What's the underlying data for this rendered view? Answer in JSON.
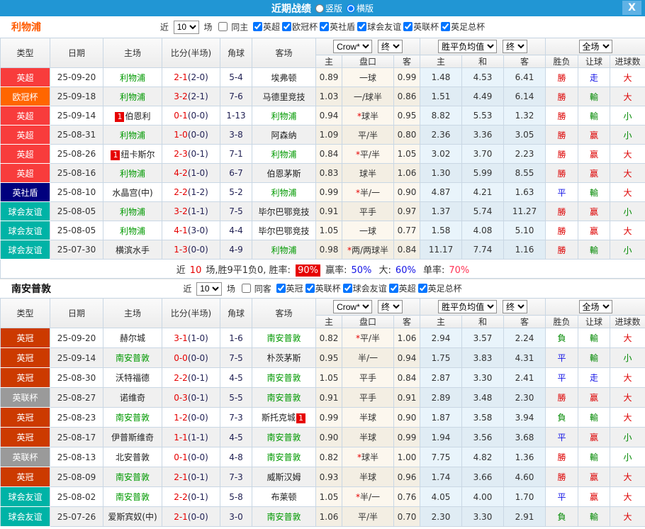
{
  "titlebar": {
    "title": "近期战绩",
    "radio_vertical": "竖版",
    "radio_horizontal": "横版",
    "close_glyph": "X"
  },
  "table_header": {
    "type": "类型",
    "date": "日期",
    "home": "主场",
    "score": "比分(半场)",
    "corner": "角球",
    "away": "客场",
    "odds_home": "主",
    "handicap": "盘口",
    "odds_away": "客",
    "avg_home": "主",
    "avg_draw": "和",
    "avg_away": "客",
    "result": "胜负",
    "handicap_result": "让球",
    "goals": "进球数",
    "dd_crow": "Crow*",
    "dd_final": "终",
    "dd_wdl_avg": "胜平负均值",
    "dd_full": "全场"
  },
  "league_colors": {
    "英超": "#f83c3c",
    "欧冠杯": "#ff6600",
    "英社盾": "#00007e",
    "球会友谊": "#00b3a6",
    "英冠": "#cc3a00",
    "英联杯": "#9a9a9a"
  },
  "result_colors": {
    "r": "#dd0000",
    "b": "#1414e6",
    "g": "#008800"
  },
  "sections": [
    {
      "team": "利物浦",
      "near_label": "近",
      "games_value": "10",
      "games_label": "场",
      "same_label": "同主",
      "same_checked": false,
      "leagues": [
        "英超",
        "欧冠杯",
        "英社盾",
        "球会友谊",
        "英联杯",
        "英足总杯"
      ],
      "rows": [
        {
          "lg": "英超",
          "dt": "25-09-20",
          "hm": "利物浦",
          "hg": true,
          "hb": false,
          "sc": "2-1",
          "hf": "(2-0)",
          "cn": "5-4",
          "aw": "埃弗顿",
          "ag": false,
          "ab": false,
          "o1": "0.89",
          "st": false,
          "hd": "一球",
          "o2": "0.99",
          "m1": "1.48",
          "mx": "4.53",
          "m2": "6.41",
          "rs": "勝",
          "rc": "r",
          "lt": "走",
          "lc": "b",
          "gl": "大",
          "gc": "r"
        },
        {
          "lg": "欧冠杯",
          "dt": "25-09-18",
          "hm": "利物浦",
          "hg": true,
          "hb": false,
          "sc": "3-2",
          "hf": "(2-1)",
          "cn": "7-6",
          "aw": "马德里竞技",
          "ag": false,
          "ab": false,
          "o1": "1.03",
          "st": false,
          "hd": "一/球半",
          "o2": "0.86",
          "m1": "1.51",
          "mx": "4.49",
          "m2": "6.14",
          "rs": "勝",
          "rc": "r",
          "lt": "輸",
          "lc": "g",
          "gl": "大",
          "gc": "r"
        },
        {
          "lg": "英超",
          "dt": "25-09-14",
          "hm": "伯恩利",
          "hg": false,
          "hb": true,
          "sc": "0-1",
          "hf": "(0-0)",
          "cn": "1-13",
          "aw": "利物浦",
          "ag": true,
          "ab": false,
          "o1": "0.94",
          "st": true,
          "hd": "球半",
          "o2": "0.95",
          "m1": "8.82",
          "mx": "5.53",
          "m2": "1.32",
          "rs": "勝",
          "rc": "r",
          "lt": "輸",
          "lc": "g",
          "gl": "小",
          "gc": "g"
        },
        {
          "lg": "英超",
          "dt": "25-08-31",
          "hm": "利物浦",
          "hg": true,
          "hb": false,
          "sc": "1-0",
          "hf": "(0-0)",
          "cn": "3-8",
          "aw": "阿森纳",
          "ag": false,
          "ab": false,
          "o1": "1.09",
          "st": false,
          "hd": "平/半",
          "o2": "0.80",
          "m1": "2.36",
          "mx": "3.36",
          "m2": "3.05",
          "rs": "勝",
          "rc": "r",
          "lt": "赢",
          "lc": "r",
          "gl": "小",
          "gc": "g"
        },
        {
          "lg": "英超",
          "dt": "25-08-26",
          "hm": "纽卡斯尔",
          "hg": false,
          "hb": true,
          "sc": "2-3",
          "hf": "(0-1)",
          "cn": "7-1",
          "aw": "利物浦",
          "ag": true,
          "ab": false,
          "o1": "0.84",
          "st": true,
          "hd": "平/半",
          "o2": "1.05",
          "m1": "3.02",
          "mx": "3.70",
          "m2": "2.23",
          "rs": "勝",
          "rc": "r",
          "lt": "赢",
          "lc": "r",
          "gl": "大",
          "gc": "r"
        },
        {
          "lg": "英超",
          "dt": "25-08-16",
          "hm": "利物浦",
          "hg": true,
          "hb": false,
          "sc": "4-2",
          "hf": "(1-0)",
          "cn": "6-7",
          "aw": "伯恩茅斯",
          "ag": false,
          "ab": false,
          "o1": "0.83",
          "st": false,
          "hd": "球半",
          "o2": "1.06",
          "m1": "1.30",
          "mx": "5.99",
          "m2": "8.55",
          "rs": "勝",
          "rc": "r",
          "lt": "赢",
          "lc": "r",
          "gl": "大",
          "gc": "r"
        },
        {
          "lg": "英社盾",
          "dt": "25-08-10",
          "hm": "水晶宫(中)",
          "hg": false,
          "hb": false,
          "sc": "2-2",
          "hf": "(1-2)",
          "cn": "5-2",
          "aw": "利物浦",
          "ag": true,
          "ab": false,
          "o1": "0.99",
          "st": true,
          "hd": "半/一",
          "o2": "0.90",
          "m1": "4.87",
          "mx": "4.21",
          "m2": "1.63",
          "rs": "平",
          "rc": "b",
          "lt": "輸",
          "lc": "g",
          "gl": "大",
          "gc": "r"
        },
        {
          "lg": "球会友谊",
          "dt": "25-08-05",
          "hm": "利物浦",
          "hg": true,
          "hb": false,
          "sc": "3-2",
          "hf": "(1-1)",
          "cn": "7-5",
          "aw": "毕尔巴鄂竞技",
          "ag": false,
          "ab": false,
          "o1": "0.91",
          "st": false,
          "hd": "平手",
          "o2": "0.97",
          "m1": "1.37",
          "mx": "5.74",
          "m2": "11.27",
          "rs": "勝",
          "rc": "r",
          "lt": "赢",
          "lc": "r",
          "gl": "小",
          "gc": "g"
        },
        {
          "lg": "球会友谊",
          "dt": "25-08-05",
          "hm": "利物浦",
          "hg": true,
          "hb": false,
          "sc": "4-1",
          "hf": "(3-0)",
          "cn": "4-4",
          "aw": "毕尔巴鄂竞技",
          "ag": false,
          "ab": false,
          "o1": "1.05",
          "st": false,
          "hd": "一球",
          "o2": "0.77",
          "m1": "1.58",
          "mx": "4.08",
          "m2": "5.10",
          "rs": "勝",
          "rc": "r",
          "lt": "赢",
          "lc": "r",
          "gl": "大",
          "gc": "r"
        },
        {
          "lg": "球会友谊",
          "dt": "25-07-30",
          "hm": "横滨水手",
          "hg": false,
          "hb": false,
          "sc": "1-3",
          "hf": "(0-0)",
          "cn": "4-9",
          "aw": "利物浦",
          "ag": true,
          "ab": false,
          "o1": "0.98",
          "st": true,
          "hd": "两/两球半",
          "o2": "0.84",
          "m1": "11.17",
          "mx": "7.74",
          "m2": "1.16",
          "rs": "勝",
          "rc": "r",
          "lt": "輸",
          "lc": "g",
          "gl": "小",
          "gc": "g"
        }
      ],
      "summary": [
        {
          "text": "近",
          "color": "#333333"
        },
        {
          "text": "10",
          "color": "#e60000"
        },
        {
          "text": "场,胜9平1负0, 胜率: ",
          "color": "#333333"
        },
        {
          "text": "90%",
          "color": "#ffffff",
          "bg": "#e60000"
        },
        {
          "text": " 赢率:",
          "color": "#333333"
        },
        {
          "text": "50%",
          "color": "#1414e6"
        },
        {
          "text": " 大:",
          "color": "#333333"
        },
        {
          "text": "60%",
          "color": "#1414e6"
        },
        {
          "text": " 单率:",
          "color": "#333333"
        },
        {
          "text": "70%",
          "color": "#ff3355"
        }
      ]
    },
    {
      "team": "南安普敦",
      "near_label": "近",
      "games_value": "10",
      "games_label": "场",
      "same_label": "同客",
      "same_checked": false,
      "leagues": [
        "英冠",
        "英联杯",
        "球会友谊",
        "英超",
        "英足总杯"
      ],
      "rows": [
        {
          "lg": "英冠",
          "dt": "25-09-20",
          "hm": "赫尔城",
          "hg": false,
          "hb": false,
          "sc": "3-1",
          "hf": "(1-0)",
          "cn": "1-6",
          "aw": "南安普敦",
          "ag": true,
          "ab": false,
          "o1": "0.82",
          "st": true,
          "hd": "平/半",
          "o2": "1.06",
          "m1": "2.94",
          "mx": "3.57",
          "m2": "2.24",
          "rs": "負",
          "rc": "g",
          "lt": "輸",
          "lc": "g",
          "gl": "大",
          "gc": "r"
        },
        {
          "lg": "英冠",
          "dt": "25-09-14",
          "hm": "南安普敦",
          "hg": true,
          "hb": false,
          "sc": "0-0",
          "hf": "(0-0)",
          "cn": "7-5",
          "aw": "朴茨茅斯",
          "ag": false,
          "ab": false,
          "o1": "0.95",
          "st": false,
          "hd": "半/一",
          "o2": "0.94",
          "m1": "1.75",
          "mx": "3.83",
          "m2": "4.31",
          "rs": "平",
          "rc": "b",
          "lt": "輸",
          "lc": "g",
          "gl": "小",
          "gc": "g"
        },
        {
          "lg": "英冠",
          "dt": "25-08-30",
          "hm": "沃特福德",
          "hg": false,
          "hb": false,
          "sc": "2-2",
          "hf": "(0-1)",
          "cn": "4-5",
          "aw": "南安普敦",
          "ag": true,
          "ab": false,
          "o1": "1.05",
          "st": false,
          "hd": "平手",
          "o2": "0.84",
          "m1": "2.87",
          "mx": "3.30",
          "m2": "2.41",
          "rs": "平",
          "rc": "b",
          "lt": "走",
          "lc": "b",
          "gl": "大",
          "gc": "r"
        },
        {
          "lg": "英联杯",
          "dt": "25-08-27",
          "hm": "诺维奇",
          "hg": false,
          "hb": false,
          "sc": "0-3",
          "hf": "(0-1)",
          "cn": "5-5",
          "aw": "南安普敦",
          "ag": true,
          "ab": false,
          "o1": "0.91",
          "st": false,
          "hd": "平手",
          "o2": "0.91",
          "m1": "2.89",
          "mx": "3.48",
          "m2": "2.30",
          "rs": "勝",
          "rc": "r",
          "lt": "赢",
          "lc": "r",
          "gl": "大",
          "gc": "r"
        },
        {
          "lg": "英冠",
          "dt": "25-08-23",
          "hm": "南安普敦",
          "hg": true,
          "hb": false,
          "sc": "1-2",
          "hf": "(0-0)",
          "cn": "7-3",
          "aw": "斯托克城",
          "ag": false,
          "ab": true,
          "o1": "0.99",
          "st": false,
          "hd": "半球",
          "o2": "0.90",
          "m1": "1.87",
          "mx": "3.58",
          "m2": "3.94",
          "rs": "負",
          "rc": "g",
          "lt": "輸",
          "lc": "g",
          "gl": "大",
          "gc": "r"
        },
        {
          "lg": "英冠",
          "dt": "25-08-17",
          "hm": "伊普斯维奇",
          "hg": false,
          "hb": false,
          "sc": "1-1",
          "hf": "(1-1)",
          "cn": "4-5",
          "aw": "南安普敦",
          "ag": true,
          "ab": false,
          "o1": "0.90",
          "st": false,
          "hd": "半球",
          "o2": "0.99",
          "m1": "1.94",
          "mx": "3.56",
          "m2": "3.68",
          "rs": "平",
          "rc": "b",
          "lt": "赢",
          "lc": "r",
          "gl": "小",
          "gc": "g"
        },
        {
          "lg": "英联杯",
          "dt": "25-08-13",
          "hm": "北安普敦",
          "hg": false,
          "hb": false,
          "sc": "0-1",
          "hf": "(0-0)",
          "cn": "4-8",
          "aw": "南安普敦",
          "ag": true,
          "ab": false,
          "o1": "0.82",
          "st": true,
          "hd": "球半",
          "o2": "1.00",
          "m1": "7.75",
          "mx": "4.82",
          "m2": "1.36",
          "rs": "勝",
          "rc": "r",
          "lt": "輸",
          "lc": "g",
          "gl": "小",
          "gc": "g"
        },
        {
          "lg": "英冠",
          "dt": "25-08-09",
          "hm": "南安普敦",
          "hg": true,
          "hb": false,
          "sc": "2-1",
          "hf": "(0-1)",
          "cn": "7-3",
          "aw": "威斯汉姆",
          "ag": false,
          "ab": false,
          "o1": "0.93",
          "st": false,
          "hd": "半球",
          "o2": "0.96",
          "m1": "1.74",
          "mx": "3.66",
          "m2": "4.60",
          "rs": "勝",
          "rc": "r",
          "lt": "赢",
          "lc": "r",
          "gl": "大",
          "gc": "r"
        },
        {
          "lg": "球会友谊",
          "dt": "25-08-02",
          "hm": "南安普敦",
          "hg": true,
          "hb": false,
          "sc": "2-2",
          "hf": "(0-1)",
          "cn": "5-8",
          "aw": "布莱顿",
          "ag": false,
          "ab": false,
          "o1": "1.05",
          "st": true,
          "hd": "半/一",
          "o2": "0.76",
          "m1": "4.05",
          "mx": "4.00",
          "m2": "1.70",
          "rs": "平",
          "rc": "b",
          "lt": "赢",
          "lc": "r",
          "gl": "大",
          "gc": "r"
        },
        {
          "lg": "球会友谊",
          "dt": "25-07-26",
          "hm": "爱斯宾奴(中)",
          "hg": false,
          "hb": false,
          "sc": "2-1",
          "hf": "(0-0)",
          "cn": "3-0",
          "aw": "南安普敦",
          "ag": true,
          "ab": false,
          "o1": "1.06",
          "st": false,
          "hd": "平/半",
          "o2": "0.70",
          "m1": "2.30",
          "mx": "3.30",
          "m2": "2.91",
          "rs": "負",
          "rc": "g",
          "lt": "輸",
          "lc": "g",
          "gl": "大",
          "gc": "r"
        }
      ],
      "summary": null
    }
  ],
  "badge_glyph": "1",
  "star_glyph": "*"
}
